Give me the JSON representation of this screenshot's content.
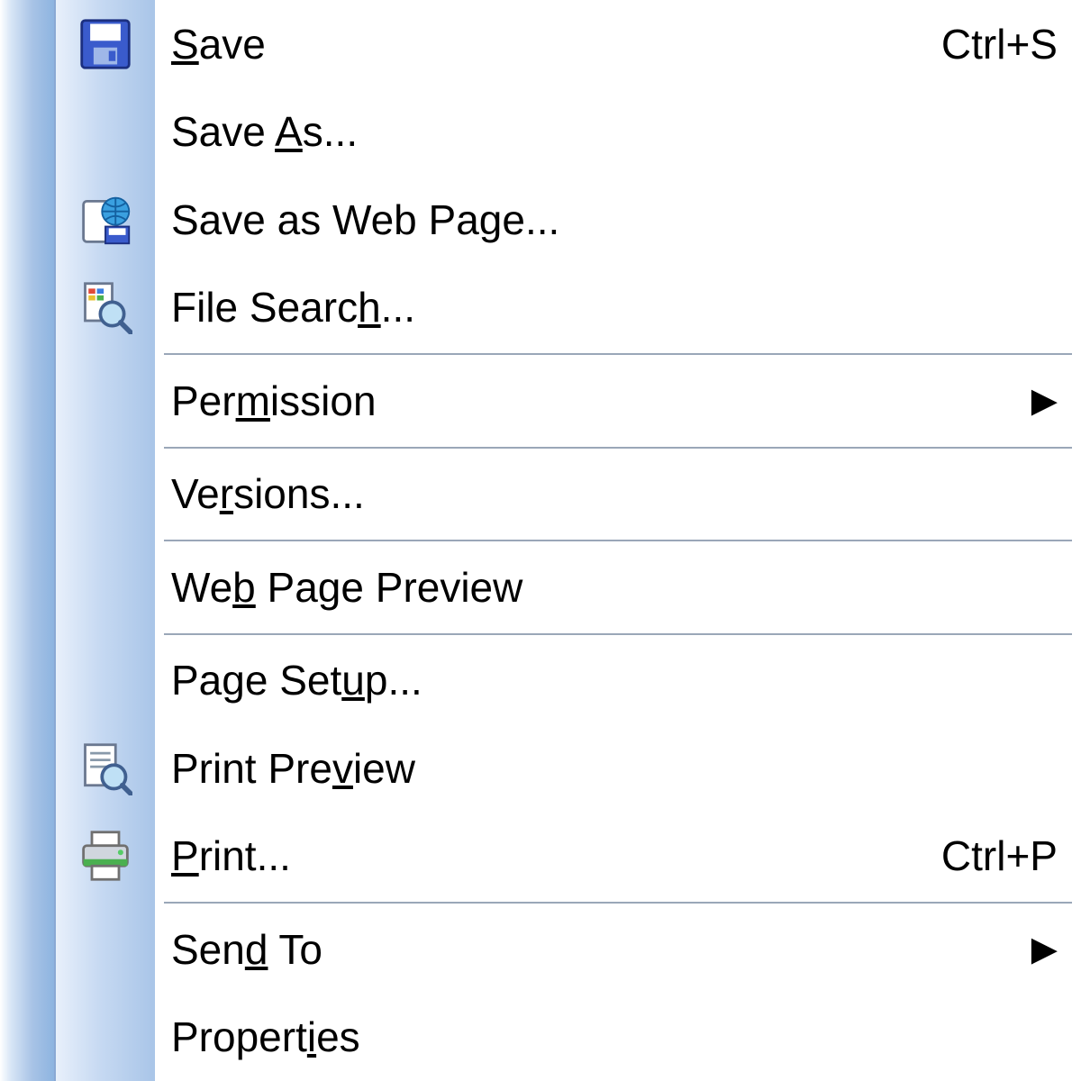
{
  "menu": {
    "items": [
      {
        "id": "save",
        "pre": "",
        "key": "S",
        "post": "ave",
        "shortcut": "Ctrl+S",
        "icon": "save-icon",
        "submenu": false,
        "sep_after": false
      },
      {
        "id": "save-as",
        "pre": "Save ",
        "key": "A",
        "post": "s...",
        "shortcut": "",
        "icon": "",
        "submenu": false,
        "sep_after": false
      },
      {
        "id": "save-as-web",
        "pre": "Save as Web Pa",
        "key": "g",
        "post": "e...",
        "shortcut": "",
        "icon": "save-web-icon",
        "submenu": false,
        "sep_after": false
      },
      {
        "id": "file-search",
        "pre": "File Searc",
        "key": "h",
        "post": "...",
        "shortcut": "",
        "icon": "file-search-icon",
        "submenu": false,
        "sep_after": true
      },
      {
        "id": "permission",
        "pre": "Per",
        "key": "m",
        "post": "ission",
        "shortcut": "",
        "icon": "",
        "submenu": true,
        "sep_after": true
      },
      {
        "id": "versions",
        "pre": "Ve",
        "key": "r",
        "post": "sions...",
        "shortcut": "",
        "icon": "",
        "submenu": false,
        "sep_after": true
      },
      {
        "id": "web-preview",
        "pre": "We",
        "key": "b",
        "post": " Page Preview",
        "shortcut": "",
        "icon": "",
        "submenu": false,
        "sep_after": true
      },
      {
        "id": "page-setup",
        "pre": "Page Set",
        "key": "u",
        "post": "p...",
        "shortcut": "",
        "icon": "",
        "submenu": false,
        "sep_after": false
      },
      {
        "id": "print-preview",
        "pre": "Print Pre",
        "key": "v",
        "post": "iew",
        "shortcut": "",
        "icon": "print-preview-icon",
        "submenu": false,
        "sep_after": false
      },
      {
        "id": "print",
        "pre": "",
        "key": "P",
        "post": "rint...",
        "shortcut": "Ctrl+P",
        "icon": "print-icon",
        "submenu": false,
        "sep_after": true
      },
      {
        "id": "send-to",
        "pre": "Sen",
        "key": "d",
        "post": " To",
        "shortcut": "",
        "icon": "",
        "submenu": true,
        "sep_after": false
      },
      {
        "id": "properties",
        "pre": "Propert",
        "key": "i",
        "post": "es",
        "shortcut": "",
        "icon": "",
        "submenu": false,
        "sep_after": false
      }
    ],
    "submenu_arrow": "▶"
  }
}
